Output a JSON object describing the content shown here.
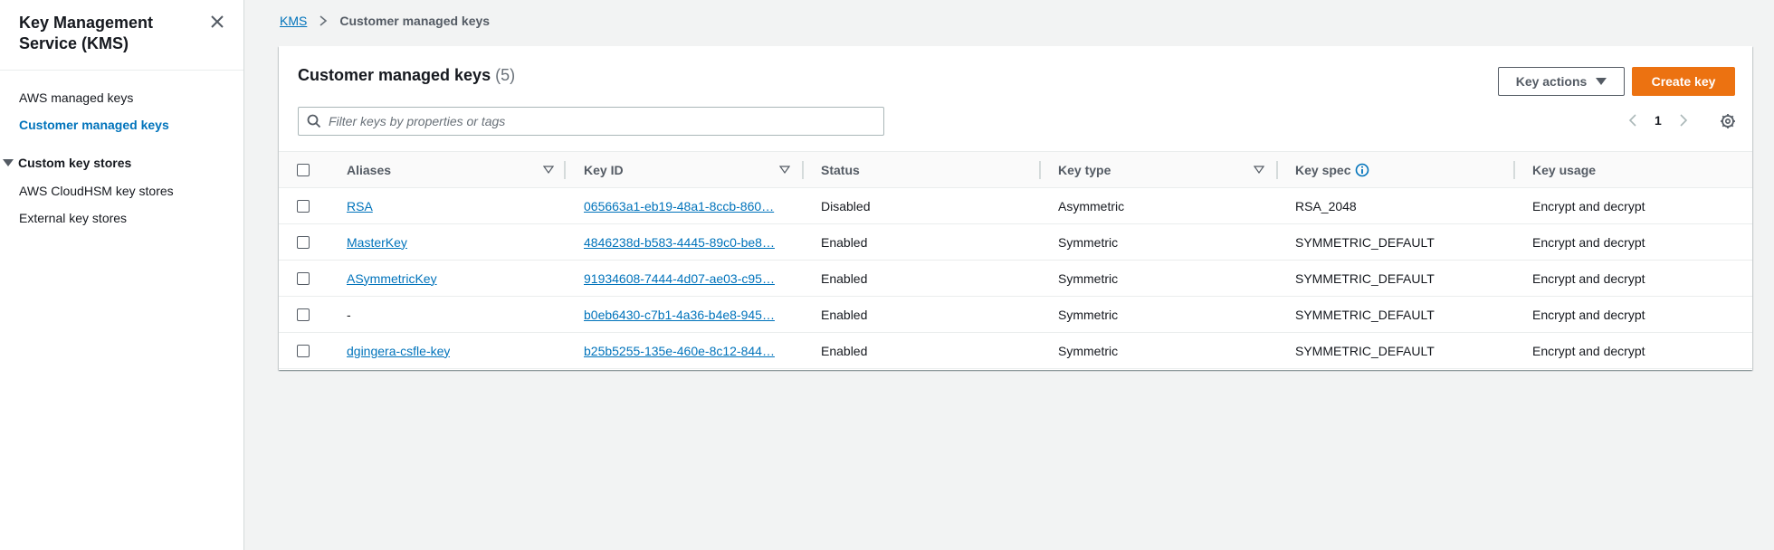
{
  "sidebar": {
    "title": "Key Management Service (KMS)",
    "items": [
      {
        "label": "AWS managed keys"
      },
      {
        "label": "Customer managed keys"
      }
    ],
    "section": {
      "label": "Custom key stores"
    },
    "section_items": [
      {
        "label": "AWS CloudHSM key stores"
      },
      {
        "label": "External key stores"
      }
    ]
  },
  "breadcrumb": {
    "root": "KMS",
    "current": "Customer managed keys"
  },
  "panel": {
    "title": "Customer managed keys",
    "count": "(5)",
    "key_actions_label": "Key actions",
    "create_key_label": "Create key",
    "search_placeholder": "Filter keys by properties or tags",
    "page_number": "1"
  },
  "table": {
    "columns": [
      "Aliases",
      "Key ID",
      "Status",
      "Key type",
      "Key spec",
      "Key usage"
    ],
    "rows": [
      {
        "alias": "RSA",
        "alias_link": true,
        "key_id": "065663a1-eb19-48a1-8ccb-860…",
        "status": "Disabled",
        "key_type": "Asymmetric",
        "key_spec": "RSA_2048",
        "key_usage": "Encrypt and decrypt"
      },
      {
        "alias": "MasterKey",
        "alias_link": true,
        "key_id": "4846238d-b583-4445-89c0-be8…",
        "status": "Enabled",
        "key_type": "Symmetric",
        "key_spec": "SYMMETRIC_DEFAULT",
        "key_usage": "Encrypt and decrypt"
      },
      {
        "alias": "ASymmetricKey",
        "alias_link": true,
        "key_id": "91934608-7444-4d07-ae03-c95…",
        "status": "Enabled",
        "key_type": "Symmetric",
        "key_spec": "SYMMETRIC_DEFAULT",
        "key_usage": "Encrypt and decrypt"
      },
      {
        "alias": "-",
        "alias_link": false,
        "key_id": "b0eb6430-c7b1-4a36-b4e8-945…",
        "status": "Enabled",
        "key_type": "Symmetric",
        "key_spec": "SYMMETRIC_DEFAULT",
        "key_usage": "Encrypt and decrypt"
      },
      {
        "alias": "dgingera-csfle-key",
        "alias_link": true,
        "key_id": "b25b5255-135e-460e-8c12-844…",
        "status": "Enabled",
        "key_type": "Symmetric",
        "key_spec": "SYMMETRIC_DEFAULT",
        "key_usage": "Encrypt and decrypt"
      }
    ]
  },
  "colors": {
    "link": "#0073bb",
    "primary_button": "#ec7211",
    "background": "#f2f3f3"
  },
  "icons": {
    "close": "close-icon",
    "breadcrumb_separator": "chevron-right-icon",
    "search": "search-icon",
    "dropdown": "caret-down-icon",
    "settings": "gear-icon",
    "info": "info-icon",
    "sort": "sort-icon"
  }
}
